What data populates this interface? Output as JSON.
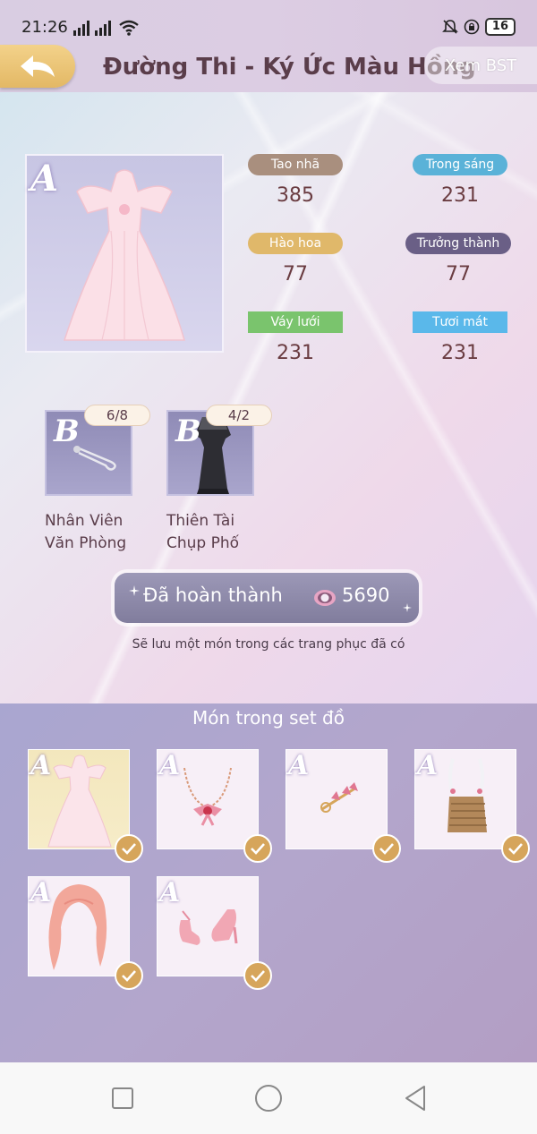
{
  "status": {
    "time": "21:26",
    "battery": "16"
  },
  "header": {
    "title": "Đường Thi - Ký Ức Màu Hồng",
    "view_collection": "Xem BST"
  },
  "stats": [
    {
      "label": "Tao nhã",
      "value": "385",
      "color": "#a98f7e"
    },
    {
      "label": "Trong sáng",
      "value": "231",
      "color": "#5ab2d8"
    },
    {
      "label": "Hào hoa",
      "value": "77",
      "color": "#e0b86a"
    },
    {
      "label": "Trưởng thành",
      "value": "77",
      "color": "#6a5f86"
    },
    {
      "label": "Váy lưới",
      "value": "231",
      "color": "#7ac46d"
    },
    {
      "label": "Tươi mát",
      "value": "231",
      "color": "#5ab8ea"
    }
  ],
  "main_item": {
    "grade": "A"
  },
  "sub_items": [
    {
      "grade": "B",
      "count": "6/8",
      "label_line1": "Nhân Viên",
      "label_line2": "Văn Phòng"
    },
    {
      "grade": "B",
      "count": "4/2",
      "label_line1": "Thiên Tài",
      "label_line2": "Chụp Phố"
    }
  ],
  "complete_button": {
    "label": "Đã hoàn thành",
    "amount": "5690"
  },
  "note": "Sẽ lưu một món trong các trang phục đã có",
  "set_section": {
    "title": "Món trong set đồ"
  },
  "set_items": [
    {
      "grade": "A",
      "icon": "dress-icon"
    },
    {
      "grade": "A",
      "icon": "necklace-icon"
    },
    {
      "grade": "A",
      "icon": "hair-clip-icon"
    },
    {
      "grade": "A",
      "icon": "bag-icon"
    },
    {
      "grade": "A",
      "icon": "hair-icon"
    },
    {
      "grade": "A",
      "icon": "shoes-icon"
    }
  ],
  "colors": {
    "accent_gold": "#d6a55b",
    "title": "#5a3d4a"
  }
}
